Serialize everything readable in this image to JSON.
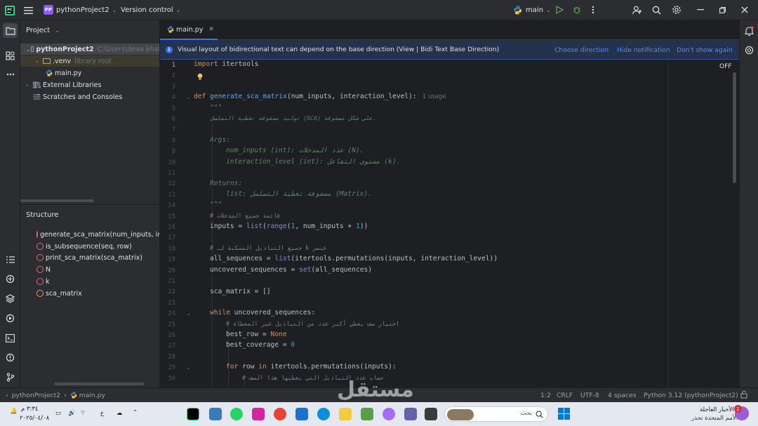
{
  "titlebar": {
    "project_badge": "PP",
    "project_name": "pythonProject2",
    "version_control": "Version control",
    "run_config": "main"
  },
  "project_panel": {
    "title": "Project",
    "root_name": "pythonProject2",
    "root_path": "C:\\Users\\deaa khal",
    "items": [
      {
        "label": ".venv",
        "hint": "library root"
      },
      {
        "label": "main.py"
      },
      {
        "label": "External Libraries"
      },
      {
        "label": "Scratches and Consoles"
      }
    ]
  },
  "structure_panel": {
    "title": "Structure",
    "items": [
      {
        "kind": "function",
        "label": "generate_sca_matrix(num_inputs, inte"
      },
      {
        "kind": "function",
        "label": "is_subsequence(seq, row)"
      },
      {
        "kind": "function",
        "label": "print_sca_matrix(sca_matrix)"
      },
      {
        "kind": "function",
        "label": "N"
      },
      {
        "kind": "function",
        "label": "k"
      },
      {
        "kind": "variable",
        "label": "sca_matrix"
      }
    ]
  },
  "editor": {
    "tab_label": "main.py",
    "notice": {
      "text": "Visual layout of bidirectional text can depend on the base direction (View | Bidi Text Base Direction)",
      "choose": "Choose direction",
      "hide": "Hide notification",
      "dont_show": "Don't show again"
    },
    "off_label": "OFF",
    "line_numbers": [
      "1",
      "2",
      "3",
      "4",
      "5",
      "6",
      "7",
      "8",
      "9",
      "10",
      "11",
      "12",
      "13",
      "14",
      "15",
      "16",
      "17",
      "18",
      "19",
      "20",
      "21",
      "22",
      "23",
      "24",
      "25",
      "26",
      "27",
      "28",
      "29",
      "30"
    ],
    "usage_hint": "1 usage",
    "code": {
      "l1_kw": "import",
      "l1_rest": " itertools",
      "l4_kw": "def",
      "l4_fn": "generate_sca_matrix",
      "l4_rest": "(num_inputs, interaction_level):",
      "l5": "\"\"\"",
      "l6": "توليد مصفوفة تغطية التسلسل (SCA) على شكل مصفوفة.",
      "l8": "Args:",
      "l9": "num_inputs (int): عدد المدخلات (N).",
      "l10": "interaction_level (int): مستوى التفاعل (k).",
      "l12": "Returns:",
      "l13": "list: مصفوفة تغطية التسلسل (Matrix).",
      "l14": "\"\"\"",
      "l15": "# قائمة جميع المدخلات",
      "l16_a": "inputs = ",
      "l16_b": "list",
      "l16_c": "(",
      "l16_d": "range",
      "l16_e": "(",
      "l16_f": "1",
      "l16_g": ", num_inputs + ",
      "l16_h": "1",
      "l16_i": "))",
      "l18": "# جميع التباديل الممكنة لـ k عنصر",
      "l19_a": "all_sequences = ",
      "l19_b": "list",
      "l19_c": "(itertools.permutations(inputs, interaction_level))",
      "l20_a": "uncovered_sequences = ",
      "l20_b": "set",
      "l20_c": "(all_sequences)",
      "l22": "sca_matrix = []",
      "l24_kw": "while",
      "l24_rest": " uncovered_sequences:",
      "l25": "# اختيار صف يغطي أكبر عدد من التباديل غير المغطاة",
      "l26_a": "best_row = ",
      "l26_b": "None",
      "l27_a": "best_coverage = ",
      "l27_b": "0",
      "l29_kw1": "for",
      "l29_mid": " row ",
      "l29_kw2": "in",
      "l29_rest": " itertools.permutations(inputs):",
      "l30": "# حساب عدد التباديل التي يغطيها هذا الصف"
    }
  },
  "statusbar": {
    "breadcrumb_project": "pythonProject2",
    "breadcrumb_file": "main.py",
    "position": "1:2",
    "line_sep": "CRLF",
    "encoding": "UTF-8",
    "indent": "4 spaces",
    "interpreter": "Python 3.12 (pythonProject2)"
  },
  "taskbar": {
    "time": "٣:٣٤ م",
    "date": "٢٠٢٥/٠٤/٠٨",
    "lang": "ع",
    "search_placeholder": "بحث",
    "news_title": "الأخبار العاجلة",
    "news_sub": "الأمم المتحدة تحذر...",
    "news_badge": "1",
    "watermark": "مستقل"
  },
  "colors": {
    "accent": "#3574f0",
    "keyword": "#cf8e6d",
    "function": "#56a8f5",
    "docstring": "#5f826b",
    "comment": "#7a7e85",
    "number": "#2aacb8"
  }
}
